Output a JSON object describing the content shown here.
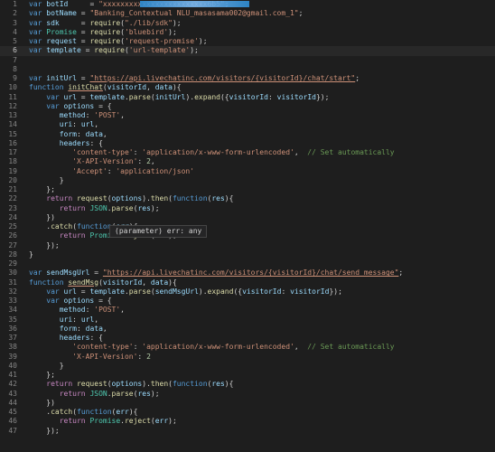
{
  "editor": {
    "lines": [
      {
        "n": "1",
        "tokens": [
          [
            "kw",
            "var "
          ],
          [
            "var",
            "botId"
          ],
          [
            "pun",
            "     = "
          ],
          [
            "str",
            "\"xxxxxxxxxxxxxxxxxxxxxxxx6b5\""
          ],
          [
            "pun",
            ";"
          ]
        ],
        "redacted": true
      },
      {
        "n": "2",
        "tokens": [
          [
            "kw",
            "var "
          ],
          [
            "var",
            "botName"
          ],
          [
            "pun",
            " = "
          ],
          [
            "str",
            "\"Banking_Contextual NLU_masasama002@gmail.com_1\""
          ],
          [
            "pun",
            ";"
          ]
        ]
      },
      {
        "n": "3",
        "tokens": [
          [
            "kw",
            "var "
          ],
          [
            "var",
            "sdk"
          ],
          [
            "pun",
            "     = "
          ],
          [
            "fn",
            "require"
          ],
          [
            "pun",
            "("
          ],
          [
            "str",
            "\"./lib/sdk\""
          ],
          [
            "pun",
            ");"
          ]
        ]
      },
      {
        "n": "4",
        "tokens": [
          [
            "kw",
            "var "
          ],
          [
            "cls",
            "Promise"
          ],
          [
            "pun",
            " = "
          ],
          [
            "fn",
            "require"
          ],
          [
            "pun",
            "("
          ],
          [
            "str",
            "'bluebird'"
          ],
          [
            "pun",
            ");"
          ]
        ]
      },
      {
        "n": "5",
        "tokens": [
          [
            "kw",
            "var "
          ],
          [
            "var",
            "request"
          ],
          [
            "pun",
            " = "
          ],
          [
            "fn",
            "require"
          ],
          [
            "pun",
            "("
          ],
          [
            "str",
            "'request-promise'"
          ],
          [
            "pun",
            ");"
          ]
        ]
      },
      {
        "n": "6",
        "tokens": [
          [
            "kw",
            "var "
          ],
          [
            "var",
            "template"
          ],
          [
            "pun",
            " = "
          ],
          [
            "fn",
            "require"
          ],
          [
            "pun",
            "("
          ],
          [
            "str",
            "'url-template'"
          ],
          [
            "pun",
            ");"
          ]
        ],
        "active": true
      },
      {
        "n": "7",
        "tokens": []
      },
      {
        "n": "8",
        "tokens": []
      },
      {
        "n": "9",
        "tokens": [
          [
            "kw",
            "var "
          ],
          [
            "var",
            "initUrl"
          ],
          [
            "pun",
            " = "
          ],
          [
            "str",
            "\"https://api.livechatinc.com/visitors/{visitorId}/chat/start\""
          ],
          [
            "pun",
            ";"
          ]
        ],
        "underline": true
      },
      {
        "n": "10",
        "tokens": [
          [
            "kw",
            "function "
          ],
          [
            "fn",
            "initChat"
          ],
          [
            "pun",
            "("
          ],
          [
            "var",
            "visitorId"
          ],
          [
            "pun",
            ", "
          ],
          [
            "var",
            "data"
          ],
          [
            "pun",
            "){"
          ]
        ],
        "fnUnderline": true
      },
      {
        "n": "11",
        "tokens": [
          [
            "pun",
            "    "
          ],
          [
            "kw",
            "var "
          ],
          [
            "var",
            "url"
          ],
          [
            "pun",
            " = "
          ],
          [
            "var",
            "template"
          ],
          [
            "pun",
            "."
          ],
          [
            "fn",
            "parse"
          ],
          [
            "pun",
            "("
          ],
          [
            "var",
            "initUrl"
          ],
          [
            "pun",
            ")."
          ],
          [
            "fn",
            "expand"
          ],
          [
            "pun",
            "({"
          ],
          [
            "var",
            "visitorId"
          ],
          [
            "pun",
            ": "
          ],
          [
            "var",
            "visitorId"
          ],
          [
            "pun",
            "});"
          ]
        ]
      },
      {
        "n": "12",
        "tokens": [
          [
            "pun",
            "    "
          ],
          [
            "kw",
            "var "
          ],
          [
            "var",
            "options"
          ],
          [
            "pun",
            " = {"
          ]
        ]
      },
      {
        "n": "13",
        "tokens": [
          [
            "pun",
            "       "
          ],
          [
            "var",
            "method"
          ],
          [
            "pun",
            ": "
          ],
          [
            "str",
            "'POST'"
          ],
          [
            "pun",
            ","
          ]
        ]
      },
      {
        "n": "14",
        "tokens": [
          [
            "pun",
            "       "
          ],
          [
            "var",
            "uri"
          ],
          [
            "pun",
            ": "
          ],
          [
            "var",
            "url"
          ],
          [
            "pun",
            ","
          ]
        ]
      },
      {
        "n": "15",
        "tokens": [
          [
            "pun",
            "       "
          ],
          [
            "var",
            "form"
          ],
          [
            "pun",
            ": "
          ],
          [
            "var",
            "data"
          ],
          [
            "pun",
            ","
          ]
        ]
      },
      {
        "n": "16",
        "tokens": [
          [
            "pun",
            "       "
          ],
          [
            "var",
            "headers"
          ],
          [
            "pun",
            ": {"
          ]
        ]
      },
      {
        "n": "17",
        "tokens": [
          [
            "pun",
            "          "
          ],
          [
            "str",
            "'content-type'"
          ],
          [
            "pun",
            ": "
          ],
          [
            "str",
            "'application/x-www-form-urlencoded'"
          ],
          [
            "pun",
            ",  "
          ],
          [
            "com",
            "// Set automatically"
          ]
        ]
      },
      {
        "n": "18",
        "tokens": [
          [
            "pun",
            "          "
          ],
          [
            "str",
            "'X-API-Version'"
          ],
          [
            "pun",
            ": "
          ],
          [
            "num",
            "2"
          ],
          [
            "pun",
            ","
          ]
        ]
      },
      {
        "n": "19",
        "tokens": [
          [
            "pun",
            "          "
          ],
          [
            "str",
            "'Accept'"
          ],
          [
            "pun",
            ": "
          ],
          [
            "str",
            "'application/json'"
          ]
        ]
      },
      {
        "n": "20",
        "tokens": [
          [
            "pun",
            "       }"
          ]
        ]
      },
      {
        "n": "21",
        "tokens": [
          [
            "pun",
            "    };"
          ]
        ]
      },
      {
        "n": "22",
        "tokens": [
          [
            "pun",
            "    "
          ],
          [
            "ctl",
            "return "
          ],
          [
            "fn",
            "request"
          ],
          [
            "pun",
            "("
          ],
          [
            "var",
            "options"
          ],
          [
            "pun",
            ")."
          ],
          [
            "fn",
            "then"
          ],
          [
            "pun",
            "("
          ],
          [
            "kw",
            "function"
          ],
          [
            "pun",
            "("
          ],
          [
            "var",
            "res"
          ],
          [
            "pun",
            "){"
          ]
        ]
      },
      {
        "n": "23",
        "tokens": [
          [
            "pun",
            "       "
          ],
          [
            "ctl",
            "return "
          ],
          [
            "cls",
            "JSON"
          ],
          [
            "pun",
            "."
          ],
          [
            "fn",
            "parse"
          ],
          [
            "pun",
            "("
          ],
          [
            "var",
            "res"
          ],
          [
            "pun",
            ");"
          ]
        ]
      },
      {
        "n": "24",
        "tokens": [
          [
            "pun",
            "    })"
          ]
        ]
      },
      {
        "n": "25",
        "tokens": [
          [
            "pun",
            "    ."
          ],
          [
            "fn",
            "catch"
          ],
          [
            "pun",
            "("
          ],
          [
            "kw",
            "function"
          ],
          [
            "pun",
            "("
          ],
          [
            "var",
            "err"
          ],
          [
            "pun",
            "){"
          ]
        ]
      },
      {
        "n": "26",
        "tokens": [
          [
            "pun",
            "       "
          ],
          [
            "ctl",
            "return "
          ],
          [
            "cls",
            "Promise"
          ],
          [
            "pun",
            "."
          ],
          [
            "fn",
            "reject"
          ],
          [
            "pun",
            "("
          ],
          [
            "var",
            "err"
          ],
          [
            "pun",
            ");"
          ]
        ]
      },
      {
        "n": "27",
        "tokens": [
          [
            "pun",
            "    });"
          ]
        ]
      },
      {
        "n": "28",
        "tokens": [
          [
            "pun",
            "}"
          ]
        ]
      },
      {
        "n": "29",
        "tokens": []
      },
      {
        "n": "30",
        "tokens": [
          [
            "kw",
            "var "
          ],
          [
            "var",
            "sendMsgUrl"
          ],
          [
            "pun",
            " = "
          ],
          [
            "str",
            "\"https://api.livechatinc.com/visitors/{visitorId}/chat/send_message\""
          ],
          [
            "pun",
            ";"
          ]
        ],
        "underline": true
      },
      {
        "n": "31",
        "tokens": [
          [
            "kw",
            "function "
          ],
          [
            "fn",
            "sendMsg"
          ],
          [
            "pun",
            "("
          ],
          [
            "var",
            "visitorId"
          ],
          [
            "pun",
            ", "
          ],
          [
            "var",
            "data"
          ],
          [
            "pun",
            "){"
          ]
        ],
        "fnUnderline": true
      },
      {
        "n": "32",
        "tokens": [
          [
            "pun",
            "    "
          ],
          [
            "kw",
            "var "
          ],
          [
            "var",
            "url"
          ],
          [
            "pun",
            " = "
          ],
          [
            "var",
            "template"
          ],
          [
            "pun",
            "."
          ],
          [
            "fn",
            "parse"
          ],
          [
            "pun",
            "("
          ],
          [
            "var",
            "sendMsgUrl"
          ],
          [
            "pun",
            ")."
          ],
          [
            "fn",
            "expand"
          ],
          [
            "pun",
            "({"
          ],
          [
            "var",
            "visitorId"
          ],
          [
            "pun",
            ": "
          ],
          [
            "var",
            "visitorId"
          ],
          [
            "pun",
            "});"
          ]
        ]
      },
      {
        "n": "33",
        "tokens": [
          [
            "pun",
            "    "
          ],
          [
            "kw",
            "var "
          ],
          [
            "var",
            "options"
          ],
          [
            "pun",
            " = {"
          ]
        ]
      },
      {
        "n": "34",
        "tokens": [
          [
            "pun",
            "       "
          ],
          [
            "var",
            "method"
          ],
          [
            "pun",
            ": "
          ],
          [
            "str",
            "'POST'"
          ],
          [
            "pun",
            ","
          ]
        ]
      },
      {
        "n": "35",
        "tokens": [
          [
            "pun",
            "       "
          ],
          [
            "var",
            "uri"
          ],
          [
            "pun",
            ": "
          ],
          [
            "var",
            "url"
          ],
          [
            "pun",
            ","
          ]
        ]
      },
      {
        "n": "36",
        "tokens": [
          [
            "pun",
            "       "
          ],
          [
            "var",
            "form"
          ],
          [
            "pun",
            ": "
          ],
          [
            "var",
            "data"
          ],
          [
            "pun",
            ","
          ]
        ]
      },
      {
        "n": "37",
        "tokens": [
          [
            "pun",
            "       "
          ],
          [
            "var",
            "headers"
          ],
          [
            "pun",
            ": {"
          ]
        ]
      },
      {
        "n": "38",
        "tokens": [
          [
            "pun",
            "          "
          ],
          [
            "str",
            "'content-type'"
          ],
          [
            "pun",
            ": "
          ],
          [
            "str",
            "'application/x-www-form-urlencoded'"
          ],
          [
            "pun",
            ",  "
          ],
          [
            "com",
            "// Set automatically"
          ]
        ]
      },
      {
        "n": "39",
        "tokens": [
          [
            "pun",
            "          "
          ],
          [
            "str",
            "'X-API-Version'"
          ],
          [
            "pun",
            ": "
          ],
          [
            "num",
            "2"
          ]
        ]
      },
      {
        "n": "40",
        "tokens": [
          [
            "pun",
            "       }"
          ]
        ]
      },
      {
        "n": "41",
        "tokens": [
          [
            "pun",
            "    };"
          ]
        ]
      },
      {
        "n": "42",
        "tokens": [
          [
            "pun",
            "    "
          ],
          [
            "ctl",
            "return "
          ],
          [
            "fn",
            "request"
          ],
          [
            "pun",
            "("
          ],
          [
            "var",
            "options"
          ],
          [
            "pun",
            ")."
          ],
          [
            "fn",
            "then"
          ],
          [
            "pun",
            "("
          ],
          [
            "kw",
            "function"
          ],
          [
            "pun",
            "("
          ],
          [
            "var",
            "res"
          ],
          [
            "pun",
            "){"
          ]
        ]
      },
      {
        "n": "43",
        "tokens": [
          [
            "pun",
            "       "
          ],
          [
            "ctl",
            "return "
          ],
          [
            "cls",
            "JSON"
          ],
          [
            "pun",
            "."
          ],
          [
            "fn",
            "parse"
          ],
          [
            "pun",
            "("
          ],
          [
            "var",
            "res"
          ],
          [
            "pun",
            ");"
          ]
        ]
      },
      {
        "n": "44",
        "tokens": [
          [
            "pun",
            "    })"
          ]
        ]
      },
      {
        "n": "45",
        "tokens": [
          [
            "pun",
            "    ."
          ],
          [
            "fn",
            "catch"
          ],
          [
            "pun",
            "("
          ],
          [
            "kw",
            "function"
          ],
          [
            "pun",
            "("
          ],
          [
            "var",
            "err"
          ],
          [
            "pun",
            "){"
          ]
        ]
      },
      {
        "n": "46",
        "tokens": [
          [
            "pun",
            "       "
          ],
          [
            "ctl",
            "return "
          ],
          [
            "cls",
            "Promise"
          ],
          [
            "pun",
            "."
          ],
          [
            "fn",
            "reject"
          ],
          [
            "pun",
            "("
          ],
          [
            "var",
            "err"
          ],
          [
            "pun",
            ");"
          ]
        ]
      },
      {
        "n": "47",
        "tokens": [
          [
            "pun",
            "    });"
          ]
        ]
      }
    ],
    "tooltip": "(parameter) err: any"
  },
  "colors": {
    "background": "#1e1e1e",
    "keyword": "#569cd6",
    "control": "#c586c0",
    "variable": "#9cdcfe",
    "function": "#dcdcaa",
    "string": "#ce9178",
    "number": "#b5cea8",
    "class": "#4ec9b0",
    "comment": "#6a9955"
  }
}
